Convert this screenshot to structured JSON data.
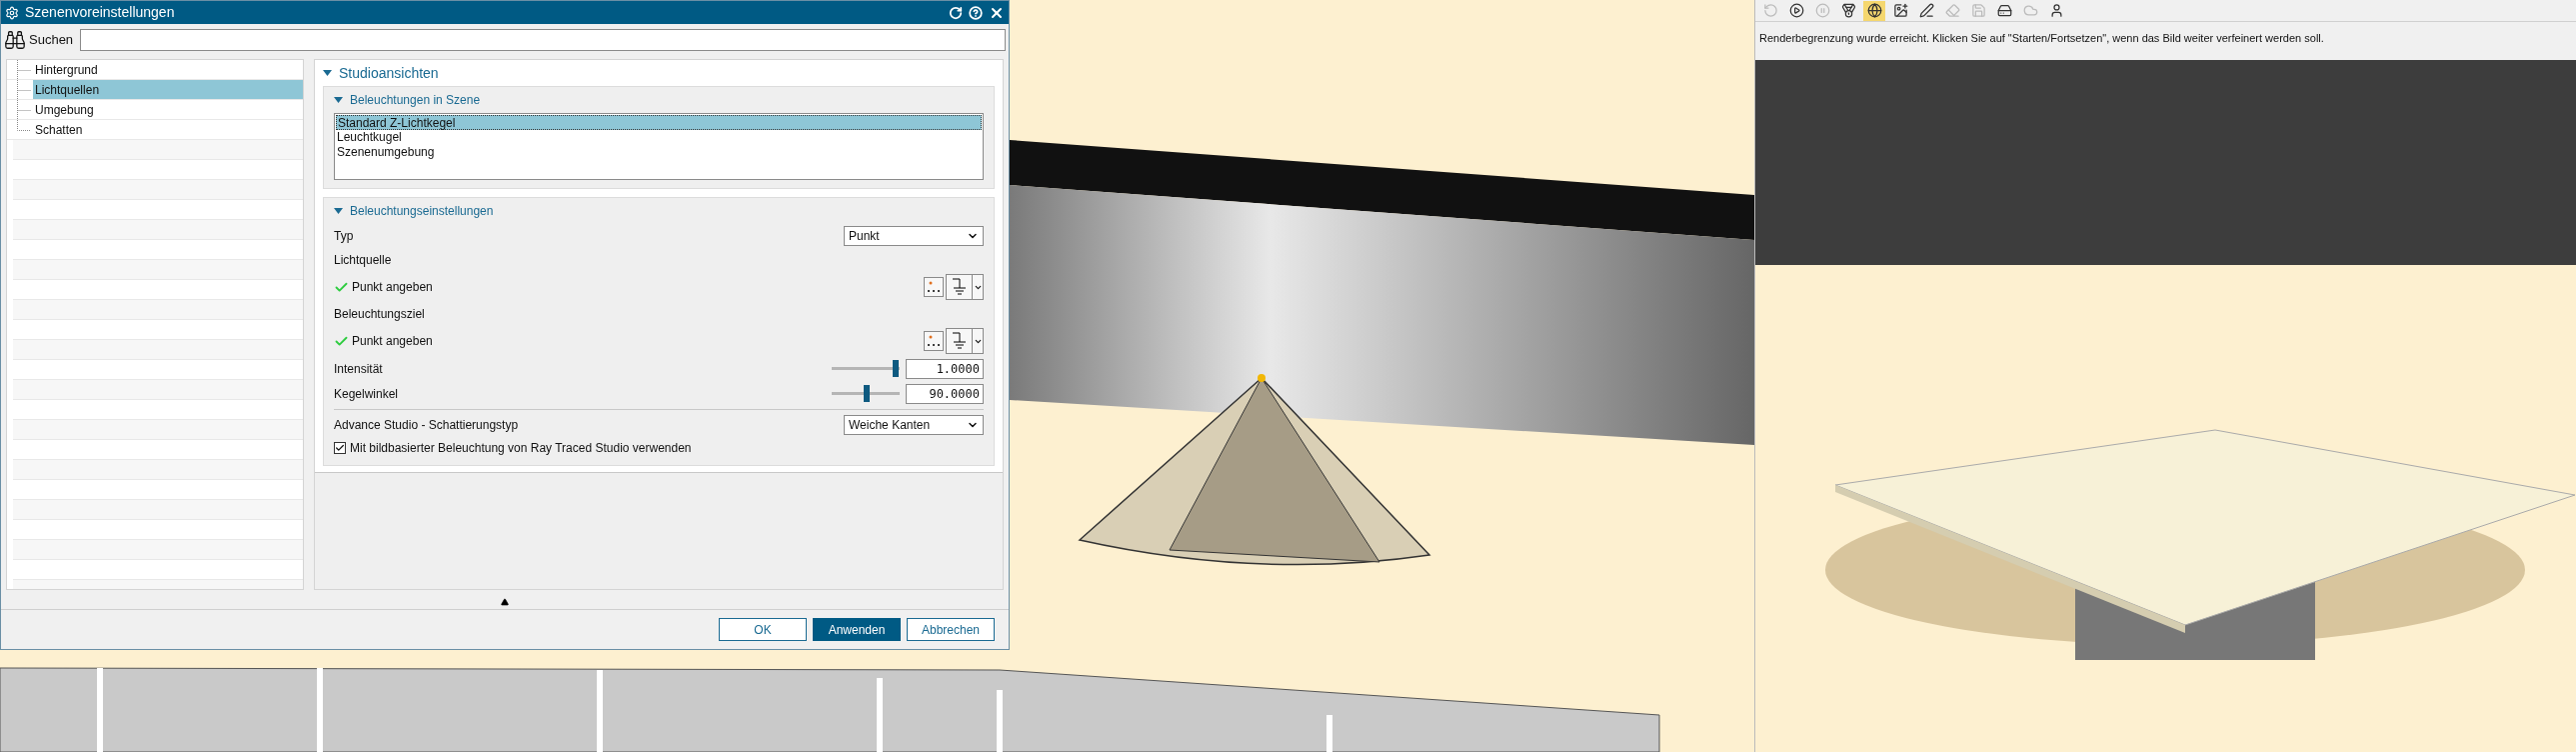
{
  "dialog": {
    "title": "Szenenvoreinstellungen",
    "search": {
      "label": "Suchen"
    },
    "tree": [
      {
        "label": "Hintergrund",
        "selected": false
      },
      {
        "label": "Lichtquellen",
        "selected": true
      },
      {
        "label": "Umgebung",
        "selected": false
      },
      {
        "label": "Schatten",
        "selected": false
      }
    ],
    "section": {
      "title": "Studioansichten",
      "expanded": true,
      "lights": {
        "title": "Beleuchtungen in Szene",
        "expanded": true,
        "items": [
          {
            "label": "Standard Z-Lichtkegel",
            "selected": true
          },
          {
            "label": "Leuchtkugel",
            "selected": false
          },
          {
            "label": "Szenenumgebung",
            "selected": false
          }
        ]
      },
      "settings": {
        "title": "Beleuchtungseinstellungen",
        "expanded": true,
        "rows": [
          {
            "kind": "dropdown",
            "label": "Typ",
            "value": "Punkt"
          },
          {
            "kind": "heading",
            "label": "Lichtquelle"
          },
          {
            "kind": "point",
            "label": "Punkt angeben",
            "done": true
          },
          {
            "kind": "heading",
            "label": "Beleuchtungsziel"
          },
          {
            "kind": "point",
            "label": "Punkt angeben",
            "done": true
          },
          {
            "kind": "slider",
            "label": "Intensität",
            "level": 0.95,
            "value": "1.0000"
          },
          {
            "kind": "slider",
            "label": "Kegelwinkel",
            "level": 0.5,
            "value": "90.0000"
          },
          {
            "kind": "divider"
          },
          {
            "kind": "dropdown",
            "label": "Advance Studio - Schattierungstyp",
            "value": "Weiche Kanten"
          },
          {
            "kind": "checkbox",
            "label": "Mit bildbasierter Beleuchtung von Ray Traced Studio verwenden",
            "checked": true
          }
        ]
      }
    },
    "buttons": [
      {
        "label": "OK",
        "kind": "default"
      },
      {
        "label": "Anwenden",
        "kind": "primary"
      },
      {
        "label": "Abbrechen",
        "kind": "default"
      }
    ]
  },
  "render_panel": {
    "message": "Renderbegrenzung wurde erreicht. Klicken Sie auf \"Starten/Fortsetzen\", wenn das Bild weiter verfeinert werden soll."
  }
}
